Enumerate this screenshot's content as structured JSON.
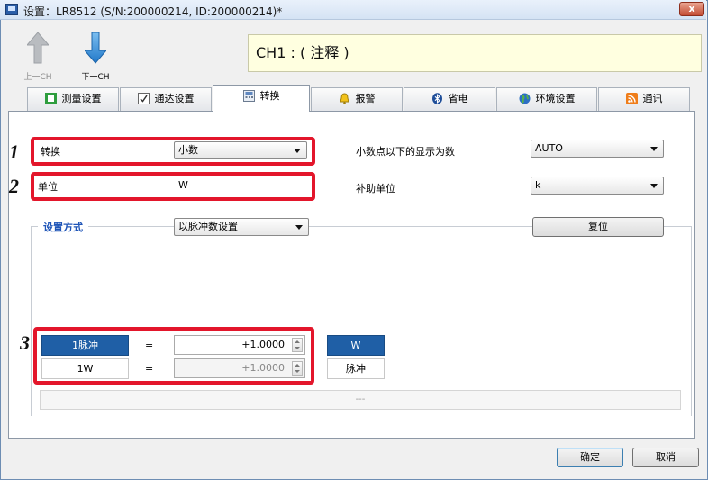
{
  "window": {
    "title": "设置：LR8512 (S/N:200000214, ID:200000214)*",
    "close_label": "x"
  },
  "nav": {
    "prev_label": "上一CH",
    "next_label": "下一CH"
  },
  "comment": {
    "text": "CH1 : ( 注释 )"
  },
  "tabs": [
    {
      "label": "测量设置",
      "icon": "measure-icon"
    },
    {
      "label": "通达设置",
      "icon": "check-icon"
    },
    {
      "label": "转换",
      "icon": "calculator-icon",
      "active": true
    },
    {
      "label": "报警",
      "icon": "bell-icon"
    },
    {
      "label": "省电",
      "icon": "bluetooth-icon"
    },
    {
      "label": "环境设置",
      "icon": "globe-icon"
    },
    {
      "label": "通讯",
      "icon": "rss-icon"
    }
  ],
  "conversion": {
    "label": "转换",
    "value": "小数"
  },
  "decimals": {
    "label": "小数点以下的显示为数",
    "value": "AUTO"
  },
  "unit": {
    "label": "单位",
    "value": "W"
  },
  "sub_unit": {
    "label": "补助单位",
    "value": "k"
  },
  "setting_method": {
    "title": "设置方式",
    "value": "以脉冲数设置",
    "reset_label": "复位"
  },
  "pulse_table": {
    "row1": {
      "left": "1脉冲",
      "eq": "=",
      "value": "+1.0000",
      "unit": "W"
    },
    "row2": {
      "left": "1W",
      "eq": "=",
      "value": "+1.0000",
      "unit": "脉冲"
    }
  },
  "status_text": "---",
  "callouts": [
    "1",
    "2",
    "3"
  ],
  "buttons": {
    "ok": "确定",
    "cancel": "取消"
  },
  "colors": {
    "highlight_red": "#e3162b",
    "accent_blue": "#1f5fa6",
    "comment_bg": "#ffffe0"
  }
}
